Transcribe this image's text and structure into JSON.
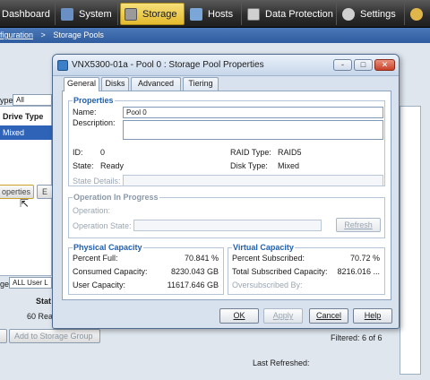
{
  "nav": {
    "tabs": [
      {
        "label": "Dashboard",
        "icon": "dashboard-icon"
      },
      {
        "label": "System",
        "icon": "system-icon"
      },
      {
        "label": "Storage",
        "icon": "storage-icon"
      },
      {
        "label": "Hosts",
        "icon": "hosts-icon"
      },
      {
        "label": "Data Protection",
        "icon": "data-protection-icon"
      },
      {
        "label": "Settings",
        "icon": "settings-icon"
      }
    ],
    "active": "Storage",
    "accent": "#e4b92d"
  },
  "breadcrumb": {
    "parent": "figuration",
    "sep": ">",
    "current": "Storage Pools"
  },
  "background": {
    "type_label": "ype",
    "type_value": "All",
    "drive_type_header": "Drive Type",
    "selected_row_drive": "Mixed",
    "properties_button": "operties",
    "e_button": "E",
    "filter_label": "ge",
    "filter_value": "ALL User L",
    "stat_header": "Stat",
    "row_value": "60 Rea",
    "add_storage_group": "Add to Storage Group",
    "filtered": "Filtered: 6 of 6",
    "last_refreshed": "Last Refreshed:"
  },
  "dialog": {
    "title": "VNX5300-01a - Pool 0 : Storage Pool Properties",
    "window_buttons": {
      "minimize": "-",
      "maximize": "□",
      "close": "✕"
    },
    "tabs": [
      "General",
      "Disks",
      "Advanced",
      "Tiering"
    ],
    "active_tab": "General",
    "properties": {
      "title": "Properties",
      "name_label": "Name:",
      "name_value": "Pool 0",
      "description_label": "Description:",
      "description_value": "",
      "id_label": "ID:",
      "id_value": "0",
      "state_label": "State:",
      "state_value": "Ready",
      "raid_type_label": "RAID Type:",
      "raid_type_value": "RAID5",
      "disk_type_label": "Disk Type:",
      "disk_type_value": "Mixed",
      "state_details_label": "State Details:",
      "state_details_value": ""
    },
    "operation": {
      "title": "Operation In Progress",
      "operation_label": "Operation:",
      "operation_state_label": "Operation State:",
      "operation_state_value": "",
      "refresh_button": "Refresh"
    },
    "physical_capacity": {
      "title": "Physical Capacity",
      "percent_full_label": "Percent Full:",
      "percent_full_value": "70.841 %",
      "consumed_label": "Consumed Capacity:",
      "consumed_value": "8230.043 GB",
      "user_label": "User Capacity:",
      "user_value": "11617.646 GB"
    },
    "virtual_capacity": {
      "title": "Virtual Capacity",
      "percent_subscribed_label": "Percent Subscribed:",
      "percent_subscribed_value": "70.72 %",
      "total_subscribed_label": "Total Subscribed Capacity:",
      "total_subscribed_value": "8216.016 ...",
      "oversubscribed_label": "Oversubscribed By:",
      "oversubscribed_value": ""
    },
    "buttons": {
      "ok": "OK",
      "apply": "Apply",
      "cancel": "Cancel",
      "help": "Help"
    }
  }
}
